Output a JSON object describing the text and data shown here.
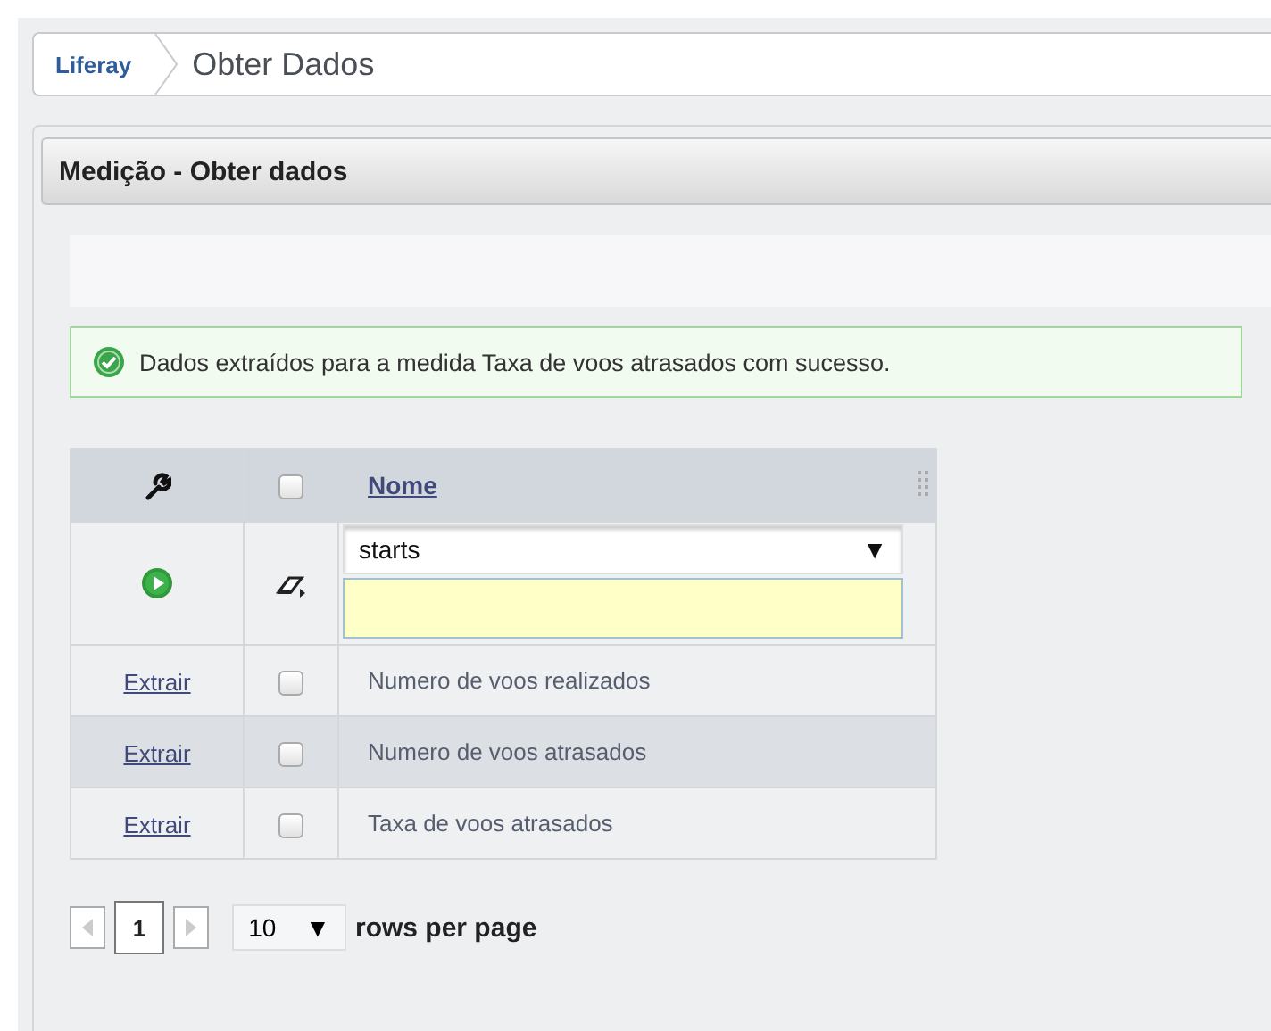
{
  "breadcrumb": [
    {
      "kind": "home",
      "label": "Liferay"
    },
    {
      "kind": "current",
      "label": "Obter Dados"
    }
  ],
  "panel": {
    "title": "Medição - Obter dados"
  },
  "message": {
    "kind": "success",
    "text": "Dados extraídos para a medida Taxa de voos atrasados com sucesso."
  },
  "table": {
    "header": {
      "checked": false,
      "column": "Nome"
    },
    "filter": {
      "operator": "starts",
      "arrow": "▼"
    },
    "rows": [
      {
        "action": "Extrair",
        "checked": false,
        "name": "Numero de voos realizados",
        "selected": false
      },
      {
        "action": "Extrair",
        "checked": false,
        "name": "Numero de voos atrasados",
        "selected": true
      },
      {
        "action": "Extrair",
        "checked": false,
        "name": "Taxa de voos atrasados",
        "selected": false
      }
    ]
  },
  "pager": {
    "pages": [
      {
        "label": "1",
        "selected": true
      }
    ],
    "page_size": "10",
    "arrow": "▼",
    "suffix": "rows per page"
  }
}
